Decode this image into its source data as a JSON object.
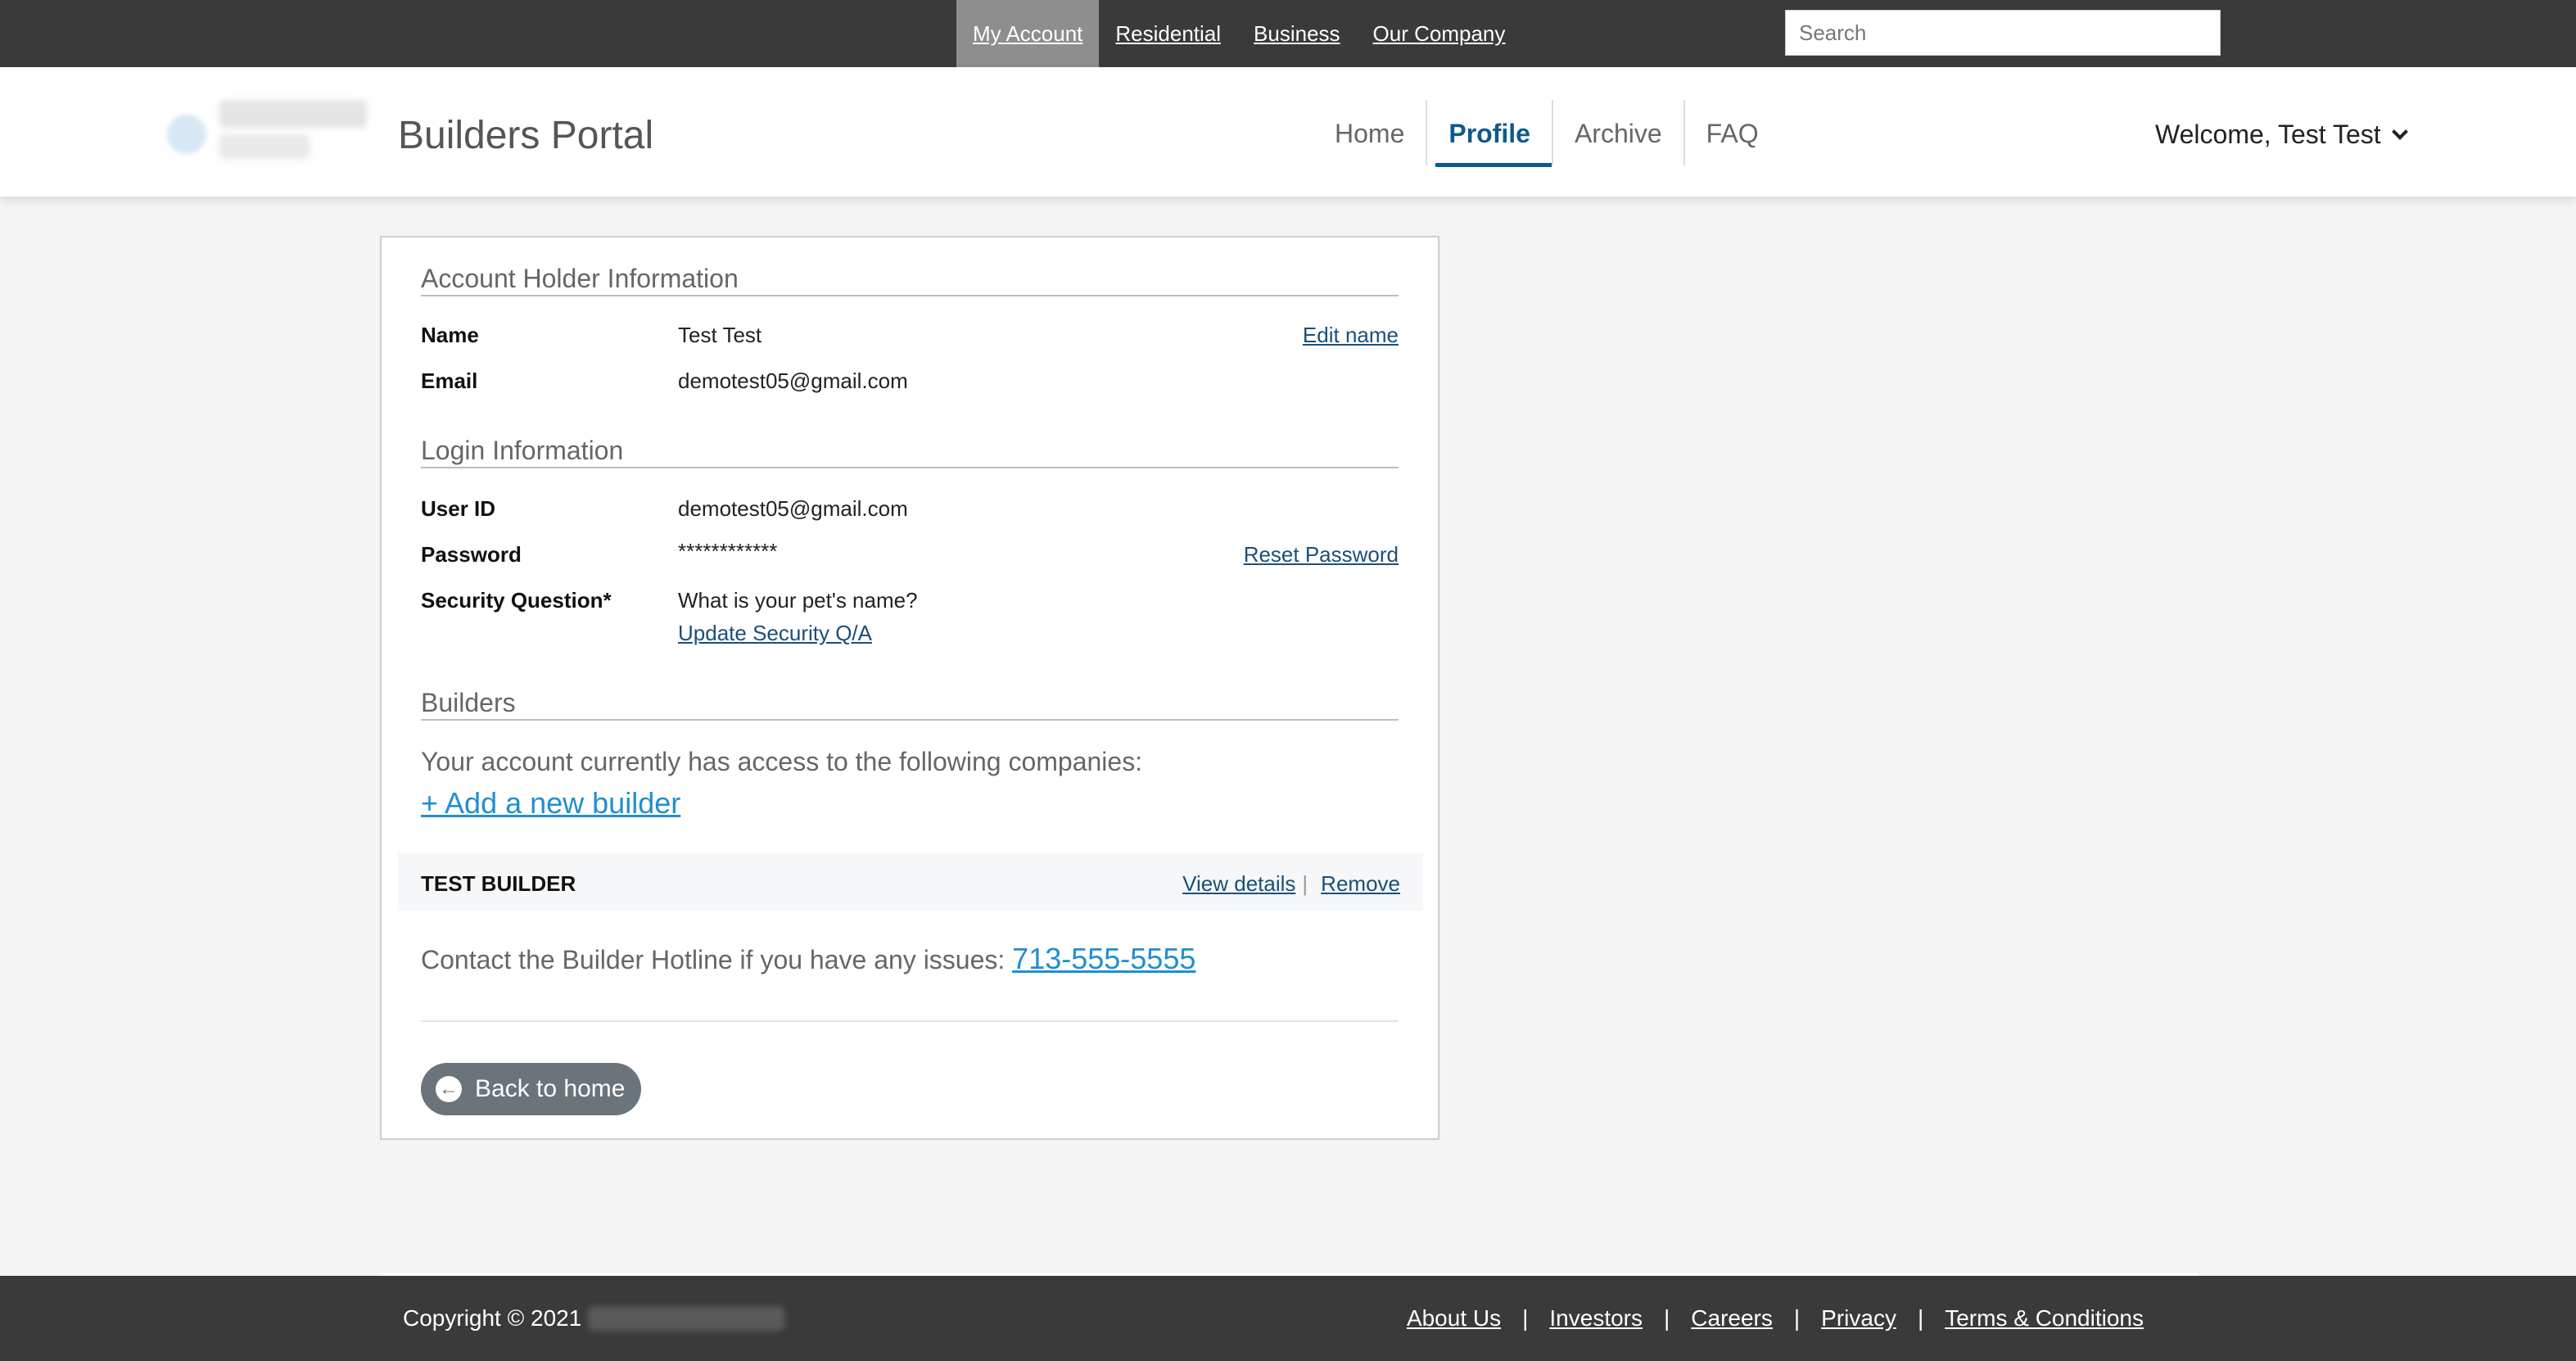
{
  "topnav": {
    "items": [
      "My Account",
      "Residential",
      "Business",
      "Our Company"
    ],
    "active_index": 0
  },
  "search": {
    "placeholder": "Search"
  },
  "header": {
    "portal_title": "Builders Portal",
    "nav": [
      "Home",
      "Profile",
      "Archive",
      "FAQ"
    ],
    "active_nav": "Profile",
    "welcome": "Welcome, Test Test"
  },
  "account_holder": {
    "title": "Account Holder Information",
    "name_label": "Name",
    "name_value": "Test Test",
    "edit_name": "Edit name",
    "email_label": "Email",
    "email_value": "demotest05@gmail.com"
  },
  "login": {
    "title": "Login Information",
    "userid_label": "User ID",
    "userid_value": "demotest05@gmail.com",
    "password_label": "Password",
    "password_value": "************",
    "reset_password": "Reset Password",
    "security_label": "Security Question*",
    "security_value": "What is your pet's name?",
    "update_security": "Update Security Q/A"
  },
  "builders": {
    "title": "Builders",
    "access_text": "Your account currently has access to the following companies:",
    "add_builder": "+ Add a new builder",
    "list": [
      {
        "name": "TEST BUILDER",
        "view_details": "View details",
        "separator": "|",
        "remove": "Remove"
      }
    ],
    "hotline_text": "Contact the Builder Hotline if you have any issues:",
    "hotline_number": "713-555-5555"
  },
  "back_button": {
    "label": "Back to home"
  },
  "footer": {
    "copyright": "Copyright © 2021",
    "links": [
      "About Us",
      "Investors",
      "Careers",
      "Privacy",
      "Terms & Conditions"
    ],
    "separator": "|"
  },
  "colors": {
    "topbar": "#3a3a3a",
    "active_nav": "#0e5a8a",
    "link_blue": "#1f8fcf",
    "button_gray": "#6b737b"
  }
}
